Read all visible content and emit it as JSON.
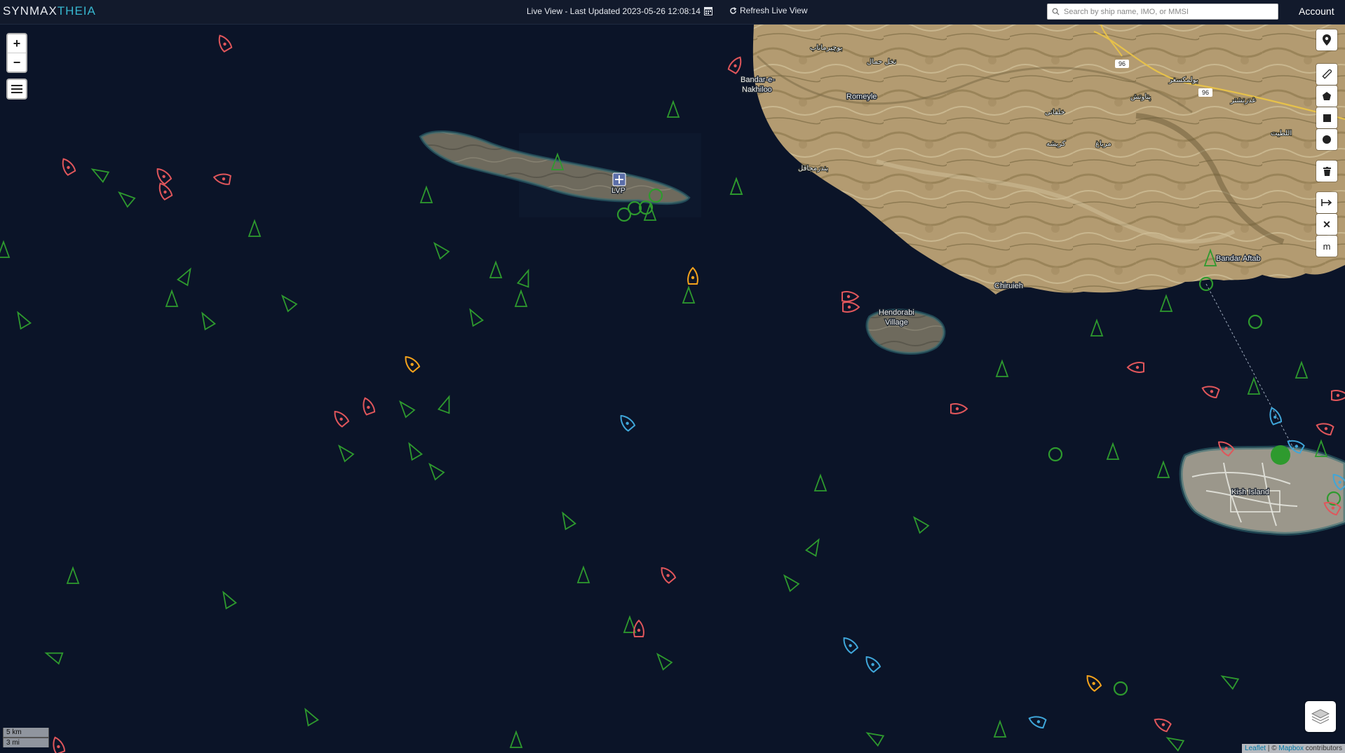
{
  "header": {
    "logo_part1": "SYNMAX",
    "logo_part2": "THEIA",
    "live_view_text": "Live View - Last Updated 2023-05-26 12:08:14",
    "refresh_label": "Refresh Live View",
    "search_placeholder": "Search by ship name, IMO, or MMSI",
    "account_label": "Account"
  },
  "map": {
    "zoom_in_label": "+",
    "zoom_out_label": "−",
    "place_labels": {
      "bandar_e_nakhiloo_1": "Bandar-e-",
      "bandar_e_nakhiloo_2": "Nakhiloo",
      "romeyle": "Romeyle",
      "chiruieh": "Chiruieh",
      "hendorabi_1": "Hendorabi",
      "hendorabi_2": "Village",
      "bandar_aftab": "Bandar Aftab",
      "kish_island": "Kish Island",
      "airport": "LVP",
      "road_96_a": "96",
      "road_96_b": "96",
      "fa_1": "بوچیرماناب",
      "fa_2": "نخل حمال",
      "fa_3": "بولمکسغر",
      "fa_4": "پتاوتش",
      "fa_5": "خلفانی",
      "fa_6": "کریشه",
      "fa_7": "مرباغ",
      "fa_8": "غدرنشتر",
      "fa_9": "اللطیت",
      "fa_10": "بندرمجاقل"
    },
    "scale_km": "5 km",
    "scale_mi": "3 mi",
    "attribution_leaflet": "Leaflet",
    "attribution_sep": " | © ",
    "attribution_mapbox": "Mapbox",
    "attribution_rest": " contributors"
  },
  "legend_colors": {
    "green_vessel": "#2e9a2e",
    "red_vessel": "#e0565b",
    "orange_vessel": "#f5a31c",
    "blue_vessel": "#3fa6d9",
    "water": "#0b1428",
    "land": "#b09a72"
  },
  "draw_tools": {
    "marker_icon": "map-pin-icon",
    "ruler_icon": "ruler-icon",
    "polygon_icon": "polygon-icon",
    "rectangle_icon": "rectangle-icon",
    "circle_icon": "circle-icon",
    "delete_icon": "trash-icon",
    "measure_icon": "measure-arrow-icon",
    "clear_label": "✕",
    "unit_label": "m"
  }
}
